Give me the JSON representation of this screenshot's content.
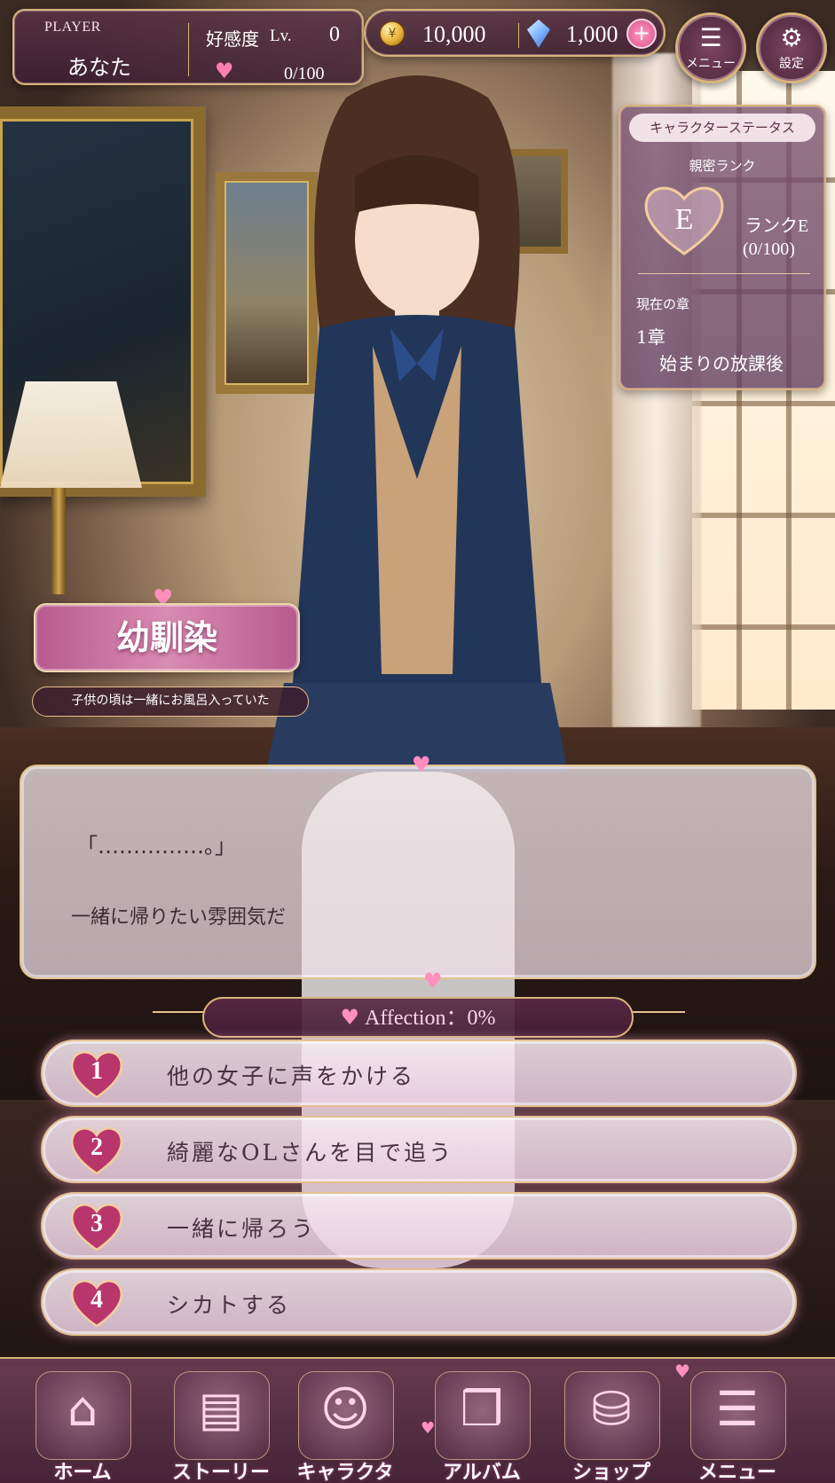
{
  "player": {
    "label": "PLAYER",
    "name": "あなた",
    "favor_label": "好感度",
    "level_label": "Lv.",
    "level": "0",
    "affection_progress": "0/100"
  },
  "currency": {
    "gold": "10,000",
    "gems": "1,000",
    "add_label": "+"
  },
  "top_buttons": {
    "menu_label": "メニュー",
    "settings_label": "設定"
  },
  "status": {
    "title": "キャラクターステータス",
    "rank_label": "親密ランク",
    "rank_letter": "E",
    "rank_name": "ランクE",
    "rank_points": "(0/100)",
    "chapter_label": "現在の章",
    "chapter_number": "1章",
    "chapter_title": "始まりの放課後"
  },
  "character": {
    "title": "幼馴染",
    "tagline": "子供の頃は一緒にお風呂入っていた"
  },
  "dialogue": {
    "line1": "「……………。」",
    "line2": "一緒に帰りたい雰囲気だ"
  },
  "affection_meter": {
    "text": "Affection：0%",
    "value_percent": 0
  },
  "choices": [
    {
      "number": "1",
      "text": "他の女子に声をかける"
    },
    {
      "number": "2",
      "text": "綺麗なOLさんを目で追う"
    },
    {
      "number": "3",
      "text": "一緒に帰ろう"
    },
    {
      "number": "4",
      "text": "シカトする"
    }
  ],
  "nav": [
    {
      "label": "ホーム",
      "icon": "castle-icon"
    },
    {
      "label": "ストーリー",
      "icon": "book-icon"
    },
    {
      "label": "キャラクター",
      "icon": "character-icon"
    },
    {
      "label": "アルバム",
      "icon": "album-icon"
    },
    {
      "label": "ショップ",
      "icon": "shopping-bag-icon"
    },
    {
      "label": "メニュー",
      "icon": "menu-icon"
    }
  ],
  "colors": {
    "accent_pink": "#ff8fbf",
    "gold_trim": "#d9b37a",
    "panel_plum": "#5a3246"
  }
}
